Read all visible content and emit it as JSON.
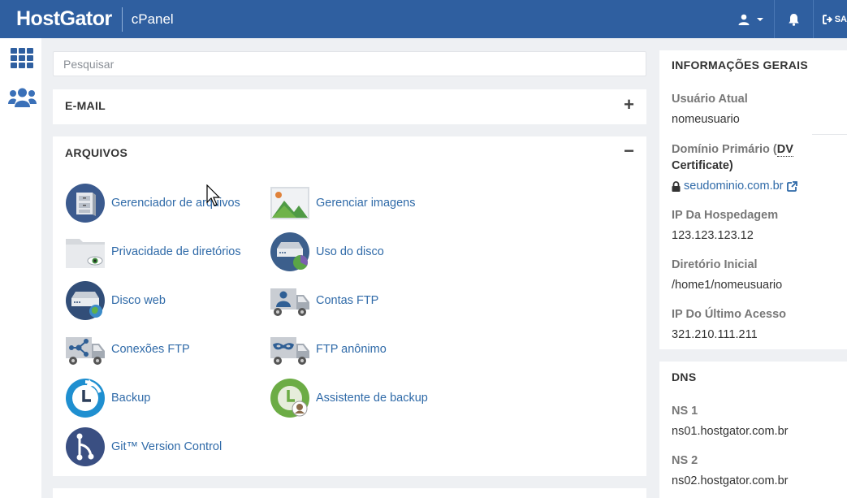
{
  "header": {
    "logo": "HostGator",
    "product": "cPanel",
    "logout_label": "SA"
  },
  "search": {
    "placeholder": "Pesquisar",
    "value": ""
  },
  "email_panel": {
    "title": "E-MAIL",
    "toggle": "+"
  },
  "files_panel": {
    "title": "ARQUIVOS",
    "toggle": "−",
    "tools": [
      {
        "label": "Gerenciador de arquivos",
        "icon": "file-manager-icon"
      },
      {
        "label": "Gerenciar imagens",
        "icon": "image-manager-icon"
      },
      {
        "label": "Privacidade de diretórios",
        "icon": "directory-privacy-icon"
      },
      {
        "label": "Uso do disco",
        "icon": "disk-usage-icon"
      },
      {
        "label": "Disco web",
        "icon": "web-disk-icon"
      },
      {
        "label": "Contas FTP",
        "icon": "ftp-accounts-icon"
      },
      {
        "label": "Conexões FTP",
        "icon": "ftp-connections-icon"
      },
      {
        "label": "FTP anônimo",
        "icon": "anonymous-ftp-icon"
      },
      {
        "label": "Backup",
        "icon": "backup-icon"
      },
      {
        "label": "Assistente de backup",
        "icon": "backup-wizard-icon"
      },
      {
        "label": "Git™ Version Control",
        "icon": "git-icon"
      }
    ]
  },
  "general_info": {
    "title": "INFORMAÇÕES GERAIS",
    "current_user_label": "Usuário Atual",
    "current_user": "nomeusuario",
    "primary_domain_label_1": "Domínio Primário (",
    "primary_domain_dv": "DV",
    "primary_domain_label_2": "Certificate)",
    "primary_domain": "seudominio.com.br",
    "hosting_ip_label": "IP Da Hospedagem",
    "hosting_ip": "123.123.123.12",
    "home_dir_label": "Diretório Inicial",
    "home_dir": "/home1/nomeusuario",
    "last_ip_label": "IP Do Último Acesso",
    "last_ip": "321.210.111.211"
  },
  "dns": {
    "title": "DNS",
    "ns1_label": "NS 1",
    "ns1": "ns01.hostgator.com.br",
    "ns2_label": "NS 2",
    "ns2": "ns02.hostgator.com.br"
  },
  "colors": {
    "header": "#2f5fa0",
    "link": "#2f6aa8",
    "background": "#eef0f3"
  }
}
